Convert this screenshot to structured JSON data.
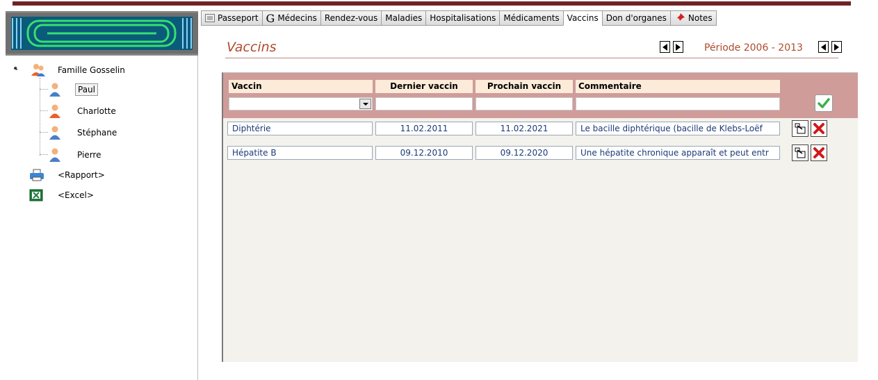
{
  "tabs": [
    {
      "label": "Passeport",
      "icon": "passport-icon"
    },
    {
      "label": "Médecins",
      "icon": "doctor-g-icon",
      "glyph": "G"
    },
    {
      "label": "Rendez-vous"
    },
    {
      "label": "Maladies"
    },
    {
      "label": "Hospitalisations"
    },
    {
      "label": "Médicaments"
    },
    {
      "label": "Vaccins",
      "active": true
    },
    {
      "label": "Don d'organes"
    },
    {
      "label": "Notes",
      "icon": "pushpin-icon"
    }
  ],
  "tree": {
    "family": "Famille Gosselin",
    "members": [
      "Paul",
      "Charlotte",
      "Stéphane",
      "Pierre"
    ],
    "selected": "Paul",
    "report": "<Rapport>",
    "excel": "<Excel>"
  },
  "page": {
    "title": "Vaccins",
    "period": "Période 2006 - 2013"
  },
  "table": {
    "headers": {
      "vaccine": "Vaccin",
      "last": "Dernier vaccin",
      "next": "Prochain vaccin",
      "comment": "Commentaire"
    },
    "rows": [
      {
        "vaccine": "Diphtérie",
        "last": "11.02.2011",
        "next": "11.02.2021",
        "comment": "Le bacille diphtérique (bacille de Klebs-Loëf"
      },
      {
        "vaccine": "Hépatite B",
        "last": "09.12.2010",
        "next": "09.12.2020",
        "comment": "Une hépatite chronique apparaît et peut entr"
      }
    ]
  },
  "colors": {
    "accent": "#b04a2c",
    "filterbar": "#cf9c9a",
    "header_cell": "#fcebd9",
    "topbar": "#6e2325",
    "cell_text": "#1b3a78"
  }
}
